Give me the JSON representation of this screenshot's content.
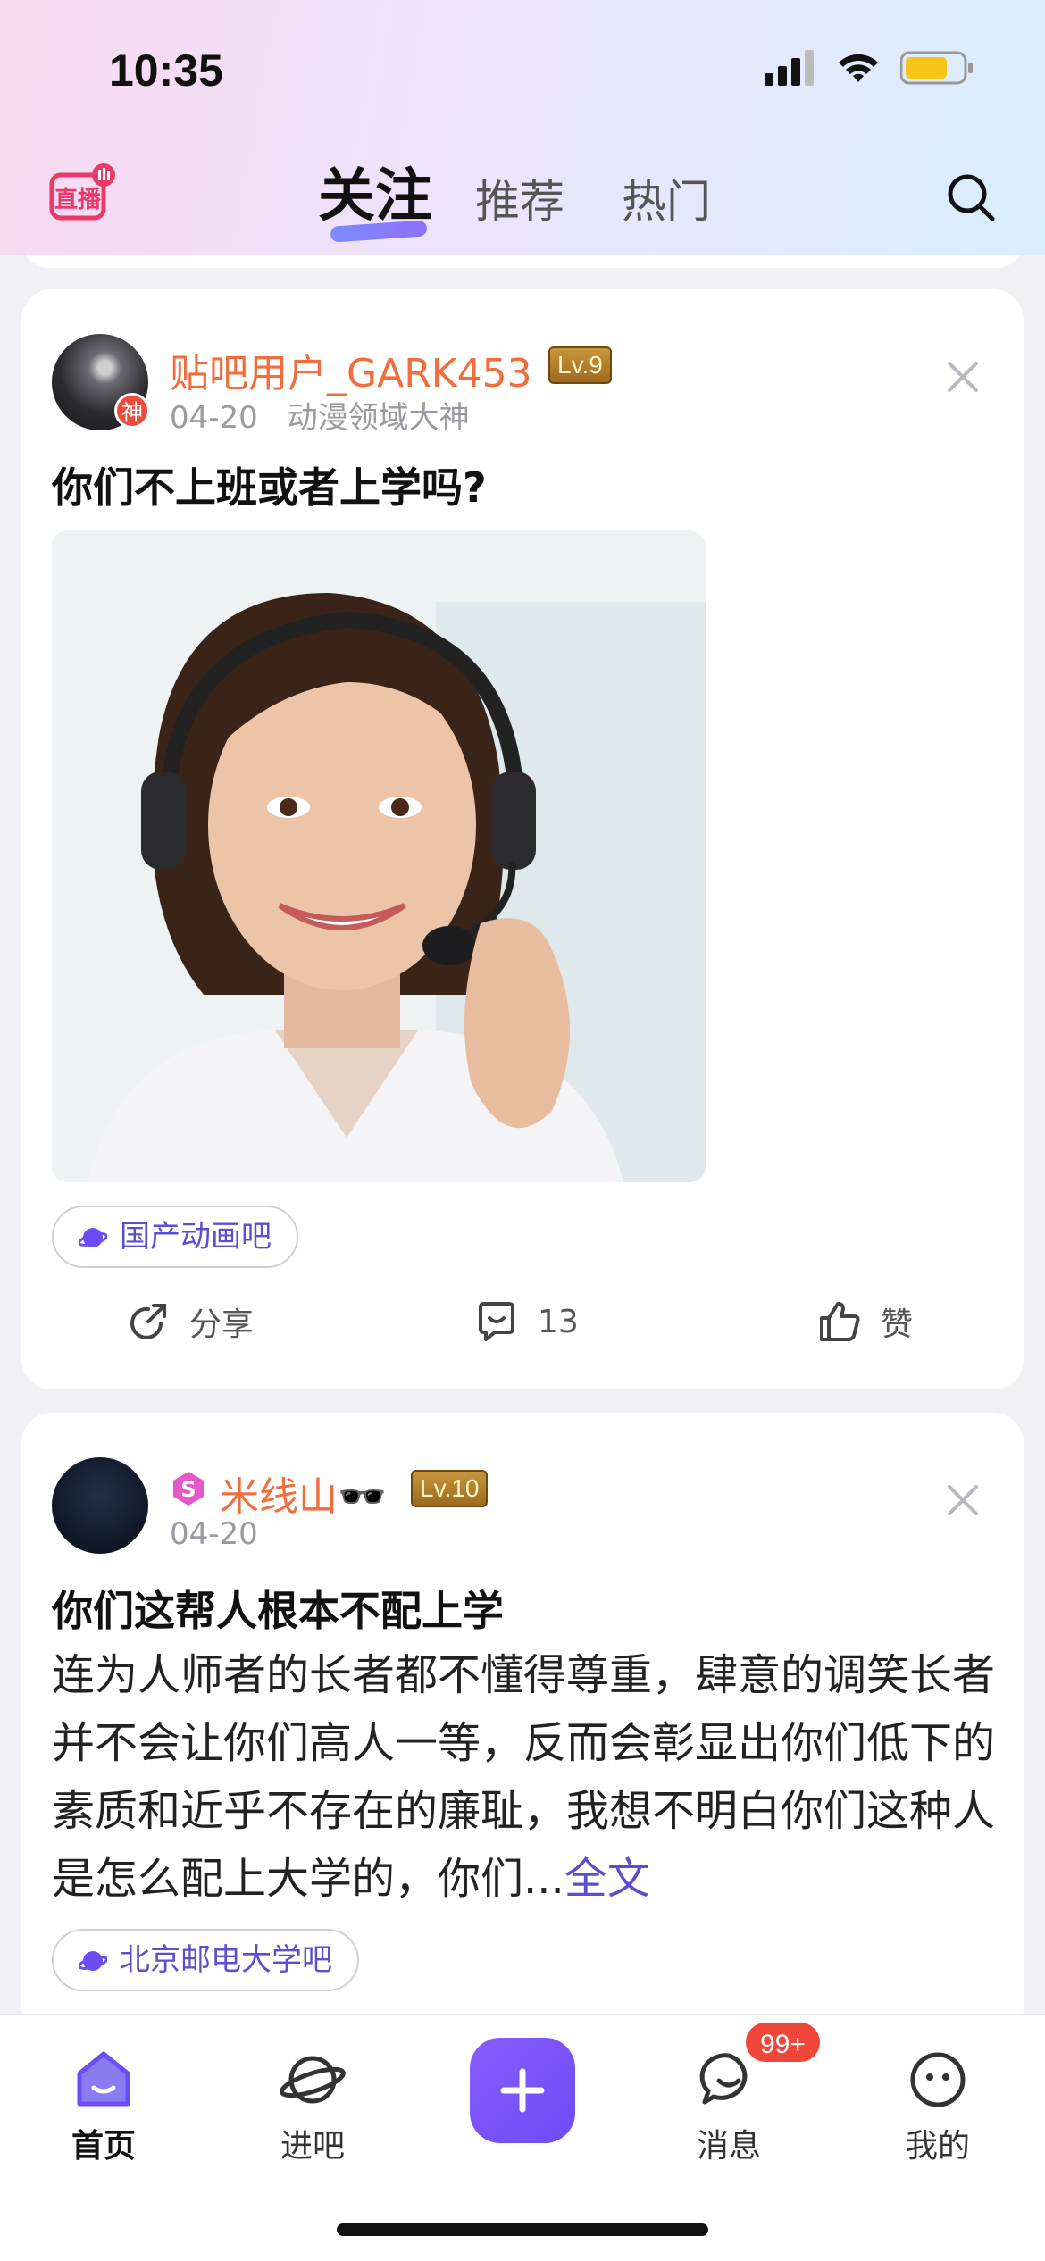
{
  "status_bar": {
    "time": "10:35"
  },
  "header": {
    "live_icon": "live-broadcast-icon",
    "tabs": [
      {
        "label": "关注",
        "active": true
      },
      {
        "label": "推荐",
        "active": false
      },
      {
        "label": "热门",
        "active": false
      }
    ],
    "search_icon": "search-icon"
  },
  "posts": [
    {
      "username": "贴吧用户_GARK453",
      "level": "Lv.9",
      "avatar_badge": "神",
      "date": "04-20",
      "user_title": "动漫领域大神",
      "title": "你们不上班或者上学吗?",
      "forum": "国产动画吧",
      "actions": {
        "share": "分享",
        "comments": "13",
        "like": "赞"
      }
    },
    {
      "username": "米线山🕶️",
      "level": "Lv.10",
      "date": "04-20",
      "title": "你们这帮人根本不配上学",
      "body": "连为人师者的长者都不懂得尊重，肆意的调笑长者并不会让你们高人一等，反而会彰显出你们低下的素质和近乎不存在的廉耻，我想不明白你们这种人是怎么配上大学的，你们...",
      "more": "全文",
      "forum": "北京邮电大学吧"
    }
  ],
  "bottom_nav": {
    "items": [
      {
        "label": "首页",
        "active": true
      },
      {
        "label": "进吧",
        "active": false
      },
      {
        "label": "消息",
        "active": false
      },
      {
        "label": "我的",
        "active": false
      }
    ],
    "message_badge": "99+"
  },
  "colors": {
    "accent": "#6c4cf5",
    "username": "#f06e3c",
    "badge": "#f0463a"
  }
}
